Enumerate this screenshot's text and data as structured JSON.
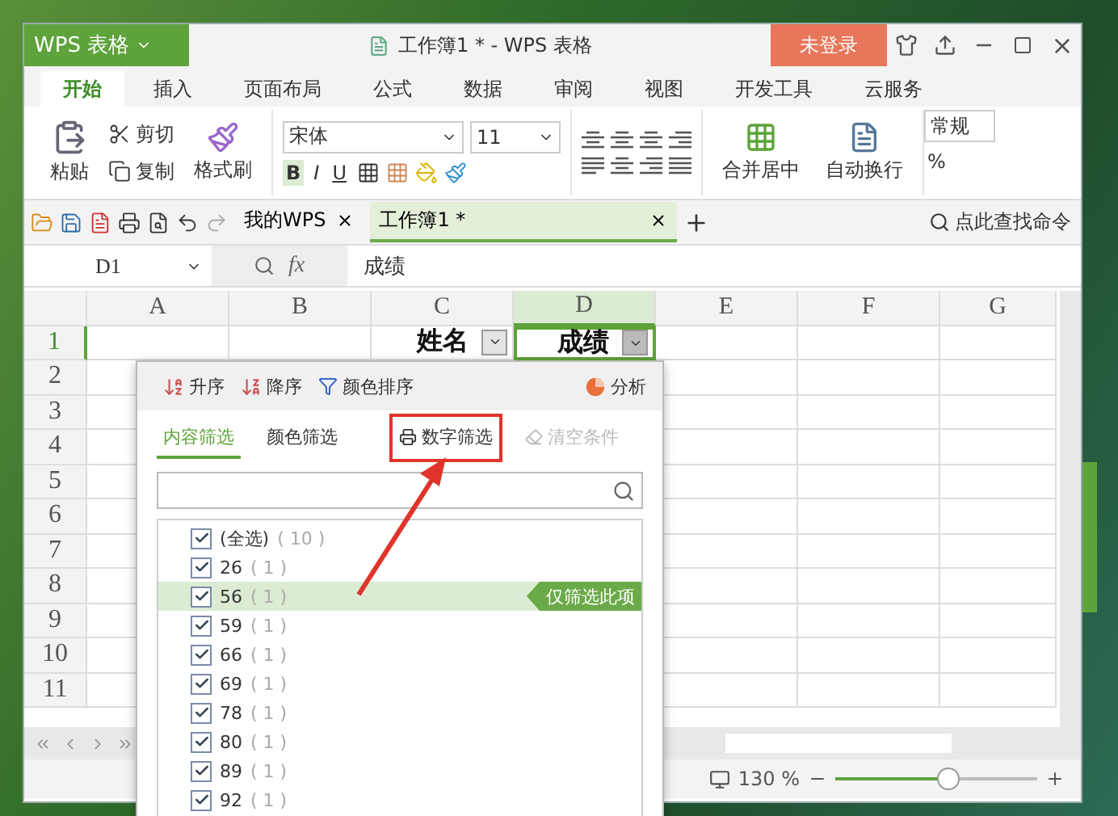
{
  "app": {
    "name": "WPS 表格",
    "title": "工作簿1 * - WPS 表格",
    "login": "未登录"
  },
  "ribbon_tabs": [
    {
      "label": "开始",
      "selected": true
    },
    {
      "label": "插入",
      "selected": false
    },
    {
      "label": "页面布局",
      "selected": false
    },
    {
      "label": "公式",
      "selected": false
    },
    {
      "label": "数据",
      "selected": false
    },
    {
      "label": "审阅",
      "selected": false
    },
    {
      "label": "视图",
      "selected": false
    },
    {
      "label": "开发工具",
      "selected": false
    },
    {
      "label": "云服务",
      "selected": false
    }
  ],
  "ribbon": {
    "paste": "粘贴",
    "cut": "剪切",
    "copy": "复制",
    "format_painter": "格式刷",
    "font": "宋体",
    "font_size": "11",
    "bold": "B",
    "italic": "I",
    "underline": "U",
    "merge": "合并居中",
    "wrap": "自动换行",
    "number_format": "常规",
    "percent": "%"
  },
  "doc_tabs": [
    {
      "label": "我的WPS",
      "selected": false
    },
    {
      "label": "工作簿1 *",
      "selected": true
    }
  ],
  "command_search": "点此查找命令",
  "formula_bar": {
    "cell": "D1",
    "fx": "fx",
    "value": "成绩"
  },
  "sheet": {
    "columns": [
      {
        "label": "A",
        "selected": false
      },
      {
        "label": "B",
        "selected": false
      },
      {
        "label": "C",
        "selected": false
      },
      {
        "label": "D",
        "selected": true
      },
      {
        "label": "E",
        "selected": false
      },
      {
        "label": "F",
        "selected": false
      },
      {
        "label": "G",
        "selected": false
      }
    ],
    "rows": [
      {
        "label": "1",
        "selected": true,
        "cells": [
          {
            "kind": "empty"
          },
          {
            "kind": "empty"
          },
          {
            "kind": "header",
            "text": "姓名",
            "active": false
          },
          {
            "kind": "header",
            "text": "成绩",
            "active": true
          }
        ]
      },
      {
        "label": "2",
        "selected": false
      },
      {
        "label": "3",
        "selected": false
      },
      {
        "label": "4",
        "selected": false
      },
      {
        "label": "5",
        "selected": false
      },
      {
        "label": "6",
        "selected": false
      },
      {
        "label": "7",
        "selected": false
      },
      {
        "label": "8",
        "selected": false
      },
      {
        "label": "9",
        "selected": false
      },
      {
        "label": "10",
        "selected": false
      },
      {
        "label": "11",
        "selected": false
      }
    ]
  },
  "filter_popup": {
    "sort": [
      "升序",
      "降序",
      "颜色排序"
    ],
    "analyze": "分析",
    "tabs": [
      {
        "label": "内容筛选",
        "selected": true,
        "disabled": false,
        "highlighted": false
      },
      {
        "label": "颜色筛选",
        "selected": false,
        "disabled": false,
        "highlighted": false
      },
      {
        "label": "数字筛选",
        "selected": false,
        "disabled": false,
        "highlighted": true
      },
      {
        "label": "清空条件",
        "selected": false,
        "disabled": true,
        "highlighted": false
      }
    ],
    "items": [
      {
        "label": "(全选)",
        "count": "( 10 )",
        "checked": true,
        "selected": false
      },
      {
        "label": "26",
        "count": "( 1 )",
        "checked": true,
        "selected": false
      },
      {
        "label": "56",
        "count": "( 1 )",
        "checked": true,
        "selected": true,
        "action": "仅筛选此项"
      },
      {
        "label": "59",
        "count": "( 1 )",
        "checked": true,
        "selected": false
      },
      {
        "label": "66",
        "count": "( 1 )",
        "checked": true,
        "selected": false
      },
      {
        "label": "69",
        "count": "( 1 )",
        "checked": true,
        "selected": false
      },
      {
        "label": "78",
        "count": "( 1 )",
        "checked": true,
        "selected": false
      },
      {
        "label": "80",
        "count": "( 1 )",
        "checked": true,
        "selected": false
      },
      {
        "label": "89",
        "count": "( 1 )",
        "checked": true,
        "selected": false
      },
      {
        "label": "92",
        "count": "( 1 )",
        "checked": true,
        "selected": false
      }
    ]
  },
  "status_bar": {
    "zoom": "130 %",
    "zoom_slider": {
      "level": 0.55
    }
  }
}
